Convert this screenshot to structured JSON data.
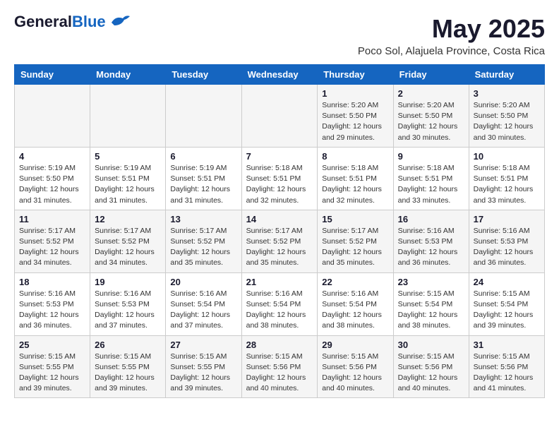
{
  "header": {
    "logo_line1": "General",
    "logo_line2": "Blue",
    "title": "May 2025",
    "subtitle": "Poco Sol, Alajuela Province, Costa Rica"
  },
  "weekdays": [
    "Sunday",
    "Monday",
    "Tuesday",
    "Wednesday",
    "Thursday",
    "Friday",
    "Saturday"
  ],
  "weeks": [
    [
      {
        "day": "",
        "info": ""
      },
      {
        "day": "",
        "info": ""
      },
      {
        "day": "",
        "info": ""
      },
      {
        "day": "",
        "info": ""
      },
      {
        "day": "1",
        "info": "Sunrise: 5:20 AM\nSunset: 5:50 PM\nDaylight: 12 hours\nand 29 minutes."
      },
      {
        "day": "2",
        "info": "Sunrise: 5:20 AM\nSunset: 5:50 PM\nDaylight: 12 hours\nand 30 minutes."
      },
      {
        "day": "3",
        "info": "Sunrise: 5:20 AM\nSunset: 5:50 PM\nDaylight: 12 hours\nand 30 minutes."
      }
    ],
    [
      {
        "day": "4",
        "info": "Sunrise: 5:19 AM\nSunset: 5:50 PM\nDaylight: 12 hours\nand 31 minutes."
      },
      {
        "day": "5",
        "info": "Sunrise: 5:19 AM\nSunset: 5:51 PM\nDaylight: 12 hours\nand 31 minutes."
      },
      {
        "day": "6",
        "info": "Sunrise: 5:19 AM\nSunset: 5:51 PM\nDaylight: 12 hours\nand 31 minutes."
      },
      {
        "day": "7",
        "info": "Sunrise: 5:18 AM\nSunset: 5:51 PM\nDaylight: 12 hours\nand 32 minutes."
      },
      {
        "day": "8",
        "info": "Sunrise: 5:18 AM\nSunset: 5:51 PM\nDaylight: 12 hours\nand 32 minutes."
      },
      {
        "day": "9",
        "info": "Sunrise: 5:18 AM\nSunset: 5:51 PM\nDaylight: 12 hours\nand 33 minutes."
      },
      {
        "day": "10",
        "info": "Sunrise: 5:18 AM\nSunset: 5:51 PM\nDaylight: 12 hours\nand 33 minutes."
      }
    ],
    [
      {
        "day": "11",
        "info": "Sunrise: 5:17 AM\nSunset: 5:52 PM\nDaylight: 12 hours\nand 34 minutes."
      },
      {
        "day": "12",
        "info": "Sunrise: 5:17 AM\nSunset: 5:52 PM\nDaylight: 12 hours\nand 34 minutes."
      },
      {
        "day": "13",
        "info": "Sunrise: 5:17 AM\nSunset: 5:52 PM\nDaylight: 12 hours\nand 35 minutes."
      },
      {
        "day": "14",
        "info": "Sunrise: 5:17 AM\nSunset: 5:52 PM\nDaylight: 12 hours\nand 35 minutes."
      },
      {
        "day": "15",
        "info": "Sunrise: 5:17 AM\nSunset: 5:52 PM\nDaylight: 12 hours\nand 35 minutes."
      },
      {
        "day": "16",
        "info": "Sunrise: 5:16 AM\nSunset: 5:53 PM\nDaylight: 12 hours\nand 36 minutes."
      },
      {
        "day": "17",
        "info": "Sunrise: 5:16 AM\nSunset: 5:53 PM\nDaylight: 12 hours\nand 36 minutes."
      }
    ],
    [
      {
        "day": "18",
        "info": "Sunrise: 5:16 AM\nSunset: 5:53 PM\nDaylight: 12 hours\nand 36 minutes."
      },
      {
        "day": "19",
        "info": "Sunrise: 5:16 AM\nSunset: 5:53 PM\nDaylight: 12 hours\nand 37 minutes."
      },
      {
        "day": "20",
        "info": "Sunrise: 5:16 AM\nSunset: 5:54 PM\nDaylight: 12 hours\nand 37 minutes."
      },
      {
        "day": "21",
        "info": "Sunrise: 5:16 AM\nSunset: 5:54 PM\nDaylight: 12 hours\nand 38 minutes."
      },
      {
        "day": "22",
        "info": "Sunrise: 5:16 AM\nSunset: 5:54 PM\nDaylight: 12 hours\nand 38 minutes."
      },
      {
        "day": "23",
        "info": "Sunrise: 5:15 AM\nSunset: 5:54 PM\nDaylight: 12 hours\nand 38 minutes."
      },
      {
        "day": "24",
        "info": "Sunrise: 5:15 AM\nSunset: 5:54 PM\nDaylight: 12 hours\nand 39 minutes."
      }
    ],
    [
      {
        "day": "25",
        "info": "Sunrise: 5:15 AM\nSunset: 5:55 PM\nDaylight: 12 hours\nand 39 minutes."
      },
      {
        "day": "26",
        "info": "Sunrise: 5:15 AM\nSunset: 5:55 PM\nDaylight: 12 hours\nand 39 minutes."
      },
      {
        "day": "27",
        "info": "Sunrise: 5:15 AM\nSunset: 5:55 PM\nDaylight: 12 hours\nand 39 minutes."
      },
      {
        "day": "28",
        "info": "Sunrise: 5:15 AM\nSunset: 5:56 PM\nDaylight: 12 hours\nand 40 minutes."
      },
      {
        "day": "29",
        "info": "Sunrise: 5:15 AM\nSunset: 5:56 PM\nDaylight: 12 hours\nand 40 minutes."
      },
      {
        "day": "30",
        "info": "Sunrise: 5:15 AM\nSunset: 5:56 PM\nDaylight: 12 hours\nand 40 minutes."
      },
      {
        "day": "31",
        "info": "Sunrise: 5:15 AM\nSunset: 5:56 PM\nDaylight: 12 hours\nand 41 minutes."
      }
    ]
  ]
}
